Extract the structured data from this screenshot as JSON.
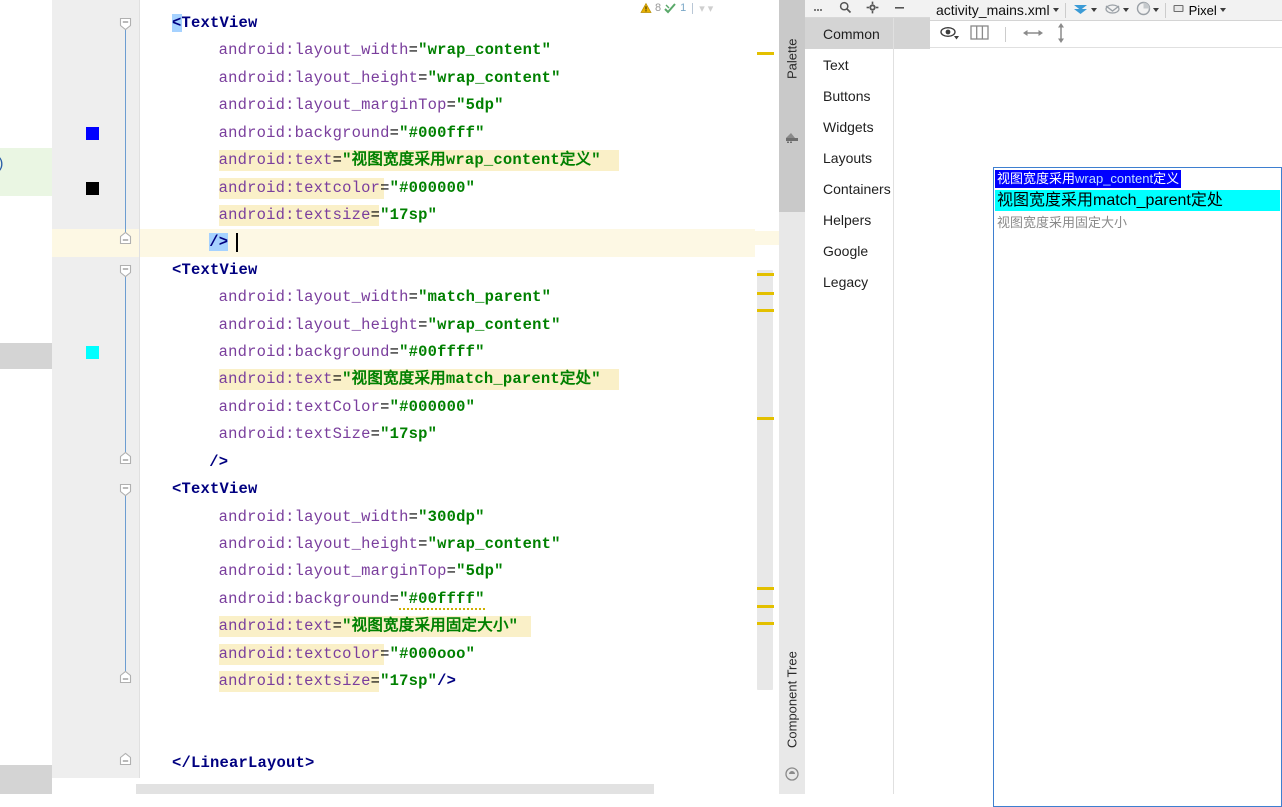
{
  "app": {
    "editor_file": "activity_mains.xml",
    "device_label": "Pixel"
  },
  "inspection": {
    "warning_icon": "warning-triangle-icon",
    "warning_count": "8",
    "ok_icon": "inspection-ok-icon",
    "ok_count": "1"
  },
  "tool_tabs": {
    "palette": "Palette",
    "component_tree": "Component Tree"
  },
  "palette": {
    "toolbar": {
      "more_icon": "more-options-icon",
      "search_icon": "search-icon",
      "settings_icon": "gear-icon",
      "minimize_icon": "minimize-icon"
    },
    "items": [
      {
        "label": "Common",
        "selected": true
      },
      {
        "label": "Text",
        "selected": false
      },
      {
        "label": "Buttons",
        "selected": false
      },
      {
        "label": "Widgets",
        "selected": false
      },
      {
        "label": "Layouts",
        "selected": false
      },
      {
        "label": "Containers",
        "selected": false
      },
      {
        "label": "Helpers",
        "selected": false
      },
      {
        "label": "Google",
        "selected": false
      },
      {
        "label": "Legacy",
        "selected": false
      }
    ]
  },
  "design_toolbar": {
    "design_mode_icon": "design-view-icon",
    "blueprint_icon": "blueprint-view-icon",
    "orientation_icon": "orientation-icon",
    "eye_icon": "visibility-eye-icon",
    "columns_icon": "split-columns-icon",
    "hresize_icon": "horizontal-resize-icon",
    "vresize_icon": "vertical-resize-icon",
    "device_icon": "device-icon"
  },
  "preview": {
    "textview_1": {
      "text_cjk_1": "视图宽度采用",
      "text_latin": "wrap_content",
      "text_cjk_2": "定义",
      "bg": "#0000ff",
      "fg": "#ffffff"
    },
    "textview_2": {
      "text": "视图宽度采用match_parent定处",
      "bg": "#00ffff",
      "fg": "#000000"
    },
    "textview_3": {
      "text": "视图宽度采用固定大小",
      "bg": "#ffffff",
      "fg": "#8a8a8a"
    }
  },
  "editor": {
    "current_line": 18,
    "gutter_swatches": [
      {
        "line": 14,
        "color": "#0000ff"
      },
      {
        "line": 16,
        "color": "#000000"
      },
      {
        "line": 22,
        "color": "#00ffff"
      }
    ],
    "lines": [
      {
        "n": 10,
        "segs": [
          {
            "t": "<",
            "c": "punct",
            "sel": true
          },
          {
            "t": "TextView",
            "c": "tag"
          }
        ]
      },
      {
        "n": 11,
        "indent": 5,
        "segs": [
          {
            "t": "android:layout_width",
            "c": "attr"
          },
          {
            "t": "=",
            "c": "eq"
          },
          {
            "t": "\"wrap_content\"",
            "c": "val"
          }
        ]
      },
      {
        "n": 12,
        "indent": 5,
        "segs": [
          {
            "t": "android:layout_height",
            "c": "attr"
          },
          {
            "t": "=",
            "c": "eq"
          },
          {
            "t": "\"wrap_content\"",
            "c": "val"
          }
        ]
      },
      {
        "n": 13,
        "indent": 5,
        "segs": [
          {
            "t": "android:layout_marginTop",
            "c": "attr"
          },
          {
            "t": "=",
            "c": "eq"
          },
          {
            "t": "\"5dp\"",
            "c": "val"
          }
        ]
      },
      {
        "n": 14,
        "indent": 5,
        "segs": [
          {
            "t": "android:background",
            "c": "attr"
          },
          {
            "t": "=",
            "c": "eq"
          },
          {
            "t": "\"#000fff\"",
            "c": "val"
          }
        ]
      },
      {
        "n": 15,
        "indent": 5,
        "hl": "full",
        "segs": [
          {
            "t": "android:text",
            "c": "attr"
          },
          {
            "t": "=",
            "c": "eq"
          },
          {
            "t": "\"视图宽度采用wrap_content定义\"",
            "c": "val"
          }
        ]
      },
      {
        "n": 16,
        "indent": 5,
        "hl": "attr",
        "segs": [
          {
            "t": "android:textcolor",
            "c": "attr"
          },
          {
            "t": "=",
            "c": "eq"
          },
          {
            "t": "\"#000000\"",
            "c": "val"
          }
        ]
      },
      {
        "n": 17,
        "indent": 5,
        "hl": "attr",
        "segs": [
          {
            "t": "android:textsize",
            "c": "attr"
          },
          {
            "t": "=",
            "c": "eq"
          },
          {
            "t": "\"17sp\"",
            "c": "val"
          }
        ]
      },
      {
        "n": 18,
        "indent": 4,
        "current": true,
        "segs": [
          {
            "t": "/>",
            "c": "punct",
            "sel": true
          }
        ]
      },
      {
        "n": 19,
        "segs": [
          {
            "t": "<",
            "c": "punct"
          },
          {
            "t": "TextView",
            "c": "tag"
          }
        ]
      },
      {
        "n": 20,
        "indent": 5,
        "segs": [
          {
            "t": "android:layout_width",
            "c": "attr"
          },
          {
            "t": "=",
            "c": "eq"
          },
          {
            "t": "\"match_parent\"",
            "c": "val"
          }
        ]
      },
      {
        "n": 21,
        "indent": 5,
        "segs": [
          {
            "t": "android:layout_height",
            "c": "attr"
          },
          {
            "t": "=",
            "c": "eq"
          },
          {
            "t": "\"wrap_content\"",
            "c": "val"
          }
        ]
      },
      {
        "n": 22,
        "indent": 5,
        "segs": [
          {
            "t": "android:background",
            "c": "attr"
          },
          {
            "t": "=",
            "c": "eq"
          },
          {
            "t": "\"#00ffff\"",
            "c": "val"
          }
        ]
      },
      {
        "n": 23,
        "indent": 5,
        "hl": "full",
        "segs": [
          {
            "t": "android:text",
            "c": "attr"
          },
          {
            "t": "=",
            "c": "eq"
          },
          {
            "t": "\"视图宽度采用match_parent定处\"",
            "c": "val"
          }
        ]
      },
      {
        "n": 24,
        "indent": 5,
        "segs": [
          {
            "t": "android:textColor",
            "c": "attr"
          },
          {
            "t": "=",
            "c": "eq"
          },
          {
            "t": "\"#000000\"",
            "c": "val"
          }
        ]
      },
      {
        "n": 25,
        "indent": 5,
        "segs": [
          {
            "t": "android:textSize",
            "c": "attr"
          },
          {
            "t": "=",
            "c": "eq"
          },
          {
            "t": "\"17sp\"",
            "c": "val"
          }
        ]
      },
      {
        "n": 26,
        "indent": 4,
        "segs": [
          {
            "t": "/>",
            "c": "punct"
          }
        ]
      },
      {
        "n": 27,
        "segs": [
          {
            "t": "<",
            "c": "punct"
          },
          {
            "t": "TextView",
            "c": "tag"
          }
        ]
      },
      {
        "n": 28,
        "indent": 5,
        "segs": [
          {
            "t": "android:layout_width",
            "c": "attr"
          },
          {
            "t": "=",
            "c": "eq"
          },
          {
            "t": "\"300dp\"",
            "c": "val"
          }
        ]
      },
      {
        "n": 29,
        "indent": 5,
        "segs": [
          {
            "t": "android:layout_height",
            "c": "attr"
          },
          {
            "t": "=",
            "c": "eq"
          },
          {
            "t": "\"wrap_content\"",
            "c": "val"
          }
        ]
      },
      {
        "n": 30,
        "indent": 5,
        "segs": [
          {
            "t": "android:layout_marginTop",
            "c": "attr"
          },
          {
            "t": "=",
            "c": "eq"
          },
          {
            "t": "\"5dp\"",
            "c": "val"
          }
        ]
      },
      {
        "n": 31,
        "indent": 5,
        "segs": [
          {
            "t": "android:background",
            "c": "attr"
          },
          {
            "t": "=",
            "c": "eq"
          },
          {
            "t": "\"#00ffff\"",
            "c": "val",
            "squiggle": true
          }
        ]
      },
      {
        "n": 32,
        "indent": 5,
        "hl": "full",
        "segs": [
          {
            "t": "android:text",
            "c": "attr"
          },
          {
            "t": "=",
            "c": "eq"
          },
          {
            "t": "\"视图宽度采用固定大小\"",
            "c": "val"
          }
        ]
      },
      {
        "n": 33,
        "indent": 5,
        "hl": "attr",
        "segs": [
          {
            "t": "android:textcolor",
            "c": "attr"
          },
          {
            "t": "=",
            "c": "eq"
          },
          {
            "t": "\"#000ooo\"",
            "c": "val"
          }
        ]
      },
      {
        "n": 34,
        "indent": 5,
        "hl": "attr",
        "segs": [
          {
            "t": "android:textsize",
            "c": "attr"
          },
          {
            "t": "=",
            "c": "eq"
          },
          {
            "t": "\"17sp\"",
            "c": "val"
          },
          {
            "t": "/>",
            "c": "punct"
          }
        ]
      },
      {
        "n": 35,
        "segs": []
      },
      {
        "n": 36,
        "segs": []
      },
      {
        "n": 37,
        "indent": 0,
        "segs": [
          {
            "t": "</",
            "c": "punct"
          },
          {
            "t": "LinearLayout",
            "c": "tag"
          },
          {
            "t": ">",
            "c": "punct"
          }
        ]
      }
    ]
  },
  "far_left": {
    "fragment_text": ")"
  }
}
